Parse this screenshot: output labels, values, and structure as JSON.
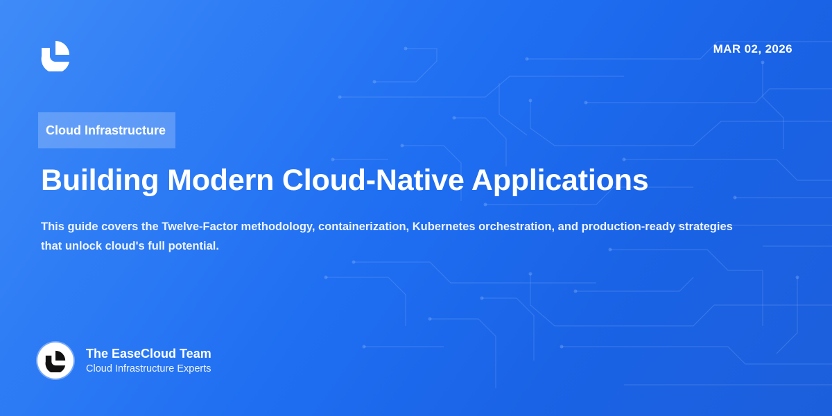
{
  "header": {
    "logo_icon": "easecloud-logo-icon",
    "date": "MAR 02, 2026"
  },
  "article": {
    "category": "Cloud Infrastructure",
    "title": "Building Modern Cloud-Native Applications",
    "description": "This guide covers the Twelve-Factor methodology, containerization, Kubernetes orchestration, and production-ready strategies that unlock cloud's full potential."
  },
  "author": {
    "avatar_icon": "easecloud-logo-icon",
    "name": "The EaseCloud Team",
    "role": "Cloud Infrastructure Experts"
  },
  "colors": {
    "background_start": "#3f8bf8",
    "background_end": "#1c5fdc",
    "text": "#ffffff",
    "circuit_line": "#9cc4ff"
  }
}
